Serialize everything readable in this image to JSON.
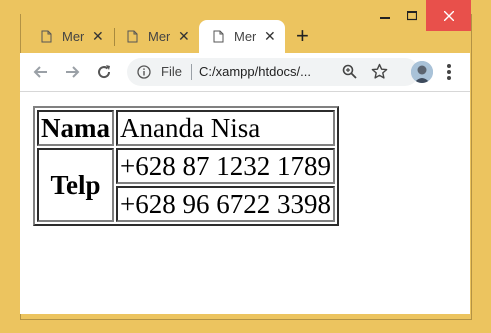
{
  "browser": {
    "tabs": [
      {
        "label": "Mer",
        "active": false
      },
      {
        "label": "Mer",
        "active": false
      },
      {
        "label": "Mer",
        "active": true
      }
    ],
    "new_tab_label": "+",
    "omnibox": {
      "scheme_label": "File",
      "url": "C:/xampp/htdocs/..."
    },
    "colors": {
      "frame": "#ecc45f",
      "close_button": "#e8504b"
    }
  },
  "table": {
    "name_header": "Nama",
    "name_value": "Ananda Nisa",
    "phone_header": "Telp",
    "phones": [
      "+628 87 1232 1789",
      "+628 96 6722 3398"
    ]
  }
}
